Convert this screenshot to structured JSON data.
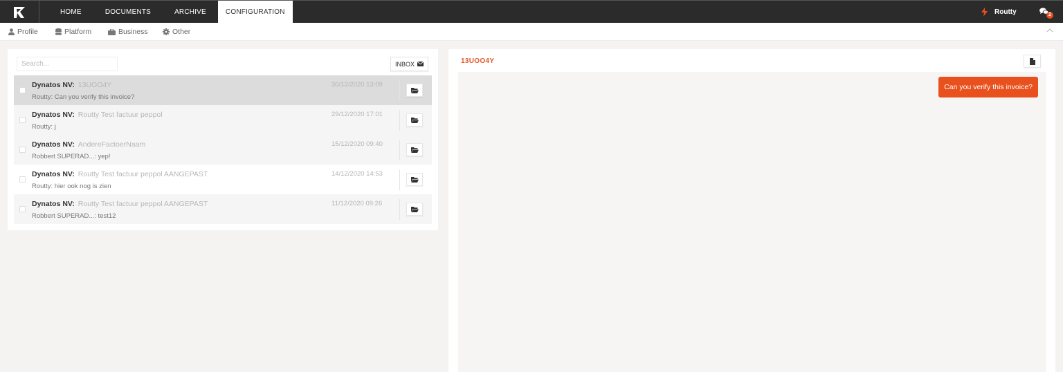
{
  "nav": {
    "items": [
      {
        "label": "HOME"
      },
      {
        "label": "DOCUMENTS"
      },
      {
        "label": "ARCHIVE"
      },
      {
        "label": "CONFIGURATION"
      }
    ],
    "active": "CONFIGURATION",
    "user_name": "Routty",
    "chat_badge": "2"
  },
  "subnav": {
    "items": [
      {
        "label": "Profile",
        "icon": "user-icon"
      },
      {
        "label": "Platform",
        "icon": "database-icon"
      },
      {
        "label": "Business",
        "icon": "briefcase-icon"
      },
      {
        "label": "Other",
        "icon": "gear-icon"
      }
    ]
  },
  "inbox": {
    "search_placeholder": "Search...",
    "inbox_label": "INBOX",
    "messages": [
      {
        "sender": "Dynatos NV:",
        "subject": "13UOO4Y",
        "preview": "Routty: Can you verify this invoice?",
        "date": "30/12/2020 13:09",
        "selected": true
      },
      {
        "sender": "Dynatos NV:",
        "subject": "Routty Test factuur peppol",
        "preview": "Routty: j",
        "date": "29/12/2020 17:01"
      },
      {
        "sender": "Dynatos NV:",
        "subject": "AndereFactoerNaam",
        "preview": "Robbert SUPERAD...: yep!",
        "date": "15/12/2020 09:40"
      },
      {
        "sender": "Dynatos NV:",
        "subject": "Routty Test factuur peppol AANGEPAST",
        "preview": "Routty: hier ook nog is zien",
        "date": "14/12/2020 14:53"
      },
      {
        "sender": "Dynatos NV:",
        "subject": "Routty Test factuur peppol AANGEPAST",
        "preview": "Robbert SUPERAD...: test12",
        "date": "11/12/2020 09:26"
      }
    ]
  },
  "conversation": {
    "title": "13UOO4Y",
    "messages": [
      {
        "text": "Can you verify this invoice?"
      }
    ]
  },
  "colors": {
    "accent": "#e8501e",
    "topbar": "#2b2b2b"
  }
}
